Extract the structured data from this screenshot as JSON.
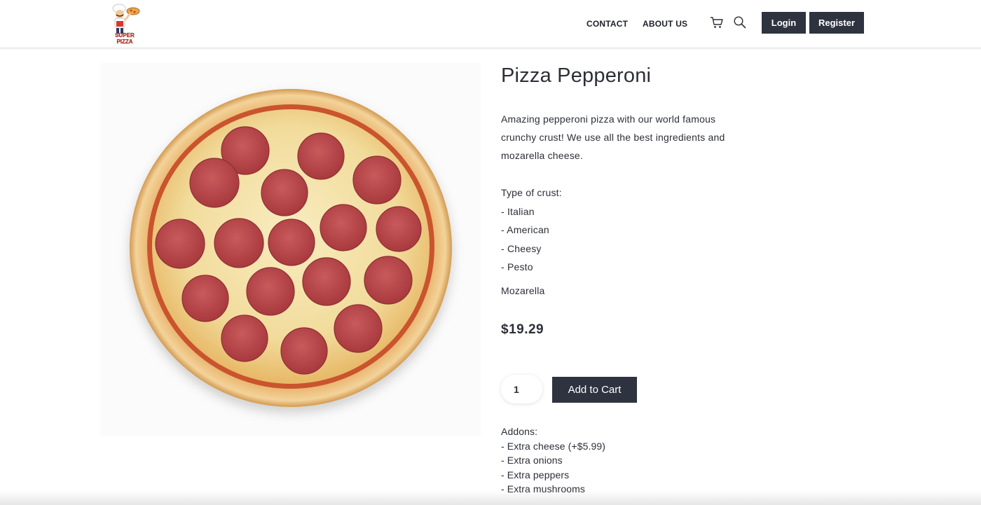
{
  "nav": {
    "contact": "CONTACT",
    "about": "ABOUT US",
    "login": "Login",
    "register": "Register",
    "cart_icon": "cart-icon",
    "search_icon": "search-icon",
    "logo_text": "SUPER PIZZA"
  },
  "product": {
    "title": "Pizza Pepperoni",
    "description": "Amazing pepperoni pizza with our world famous crunchy crust! We use all the best ingredients and mozarella cheese.",
    "crust_heading": "Type of crust:",
    "crust_options": [
      "- Italian",
      "- American",
      "- Cheesy",
      "- Pesto"
    ],
    "cheese": "Mozarella",
    "price": "$19.29",
    "quantity": "1",
    "add_to_cart": "Add to Cart",
    "addons_heading": "Addons:",
    "addons": [
      "- Extra cheese (+$5.99)",
      "- Extra onions",
      "- Extra peppers",
      "- Extra mushrooms"
    ]
  },
  "colors": {
    "dark_button": "#2f3340",
    "text": "#2d2f38",
    "pepperoni": "#b8484b",
    "cheese": "#f3e2a6",
    "crust": "#e0a866"
  }
}
